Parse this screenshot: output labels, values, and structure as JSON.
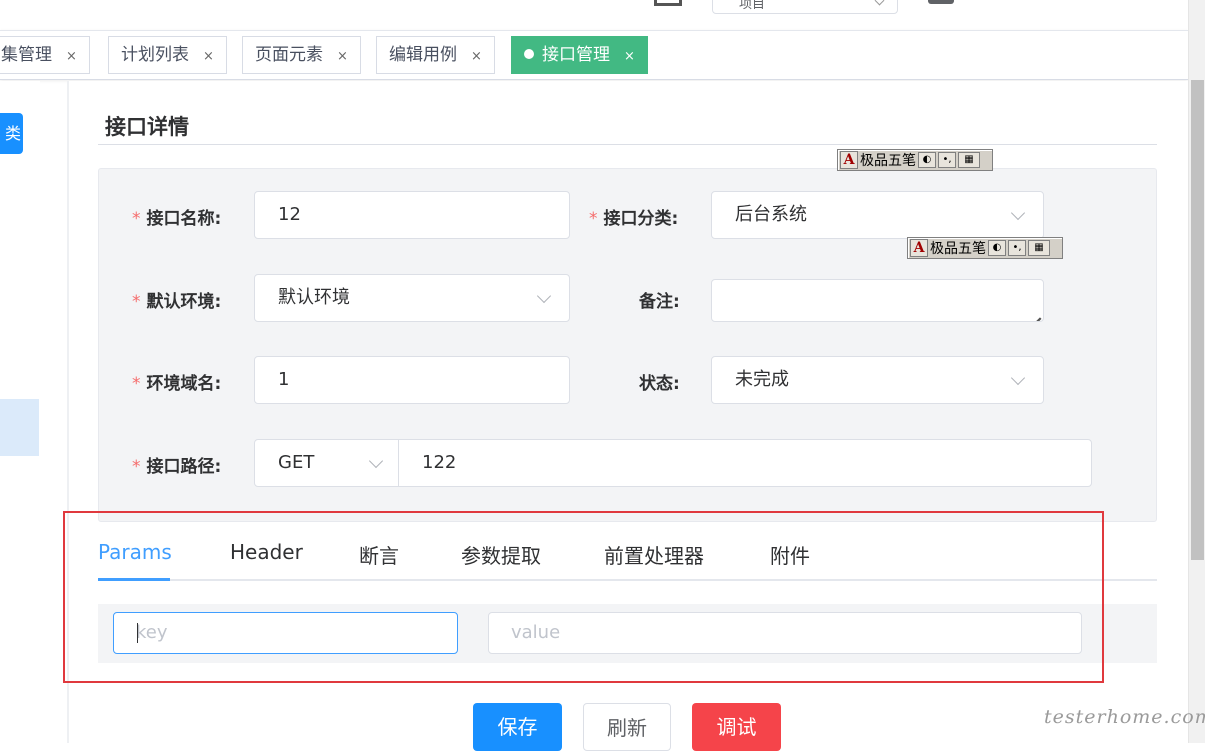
{
  "header": {
    "select_value": "项目"
  },
  "tags": [
    {
      "label": "用例集管理",
      "visible_label": "集管理",
      "active": false
    },
    {
      "label": "计划列表",
      "active": false
    },
    {
      "label": "页面元素",
      "active": false
    },
    {
      "label": "编辑用例",
      "active": false
    },
    {
      "label": "接口管理",
      "active": true
    }
  ],
  "tag_close": "×",
  "sidebar": {
    "button_label": "类"
  },
  "page": {
    "title": "接口详情"
  },
  "form": {
    "required_mark": "*",
    "name_label": "接口名称:",
    "name_value": "12",
    "category_label": "接口分类:",
    "category_value": "后台系统",
    "env_label": "默认环境:",
    "env_value": "默认环境",
    "remark_label": "备注:",
    "remark_value": "",
    "domain_label": "环境域名:",
    "domain_value": "1",
    "status_label": "状态:",
    "status_value": "未完成",
    "path_label": "接口路径:",
    "method_value": "GET",
    "path_value": "122"
  },
  "ime_toolbar": {
    "badge": "A",
    "name": "极品五笔",
    "icon_moon": "◐",
    "icon_punct": "•,"
  },
  "tabs": [
    "Params",
    "Header",
    "断言",
    "参数提取",
    "前置处理器",
    "附件"
  ],
  "params": {
    "key_placeholder": "key",
    "value_placeholder": "value"
  },
  "actions": {
    "save": "保存",
    "refresh": "刷新",
    "debug": "调试"
  },
  "watermark": "testerhome.com",
  "colors": {
    "primary": "#1890ff",
    "active_tag": "#42b983",
    "danger": "#f5444a",
    "required": "#f56c6c",
    "annotation_box": "#e0393e"
  }
}
